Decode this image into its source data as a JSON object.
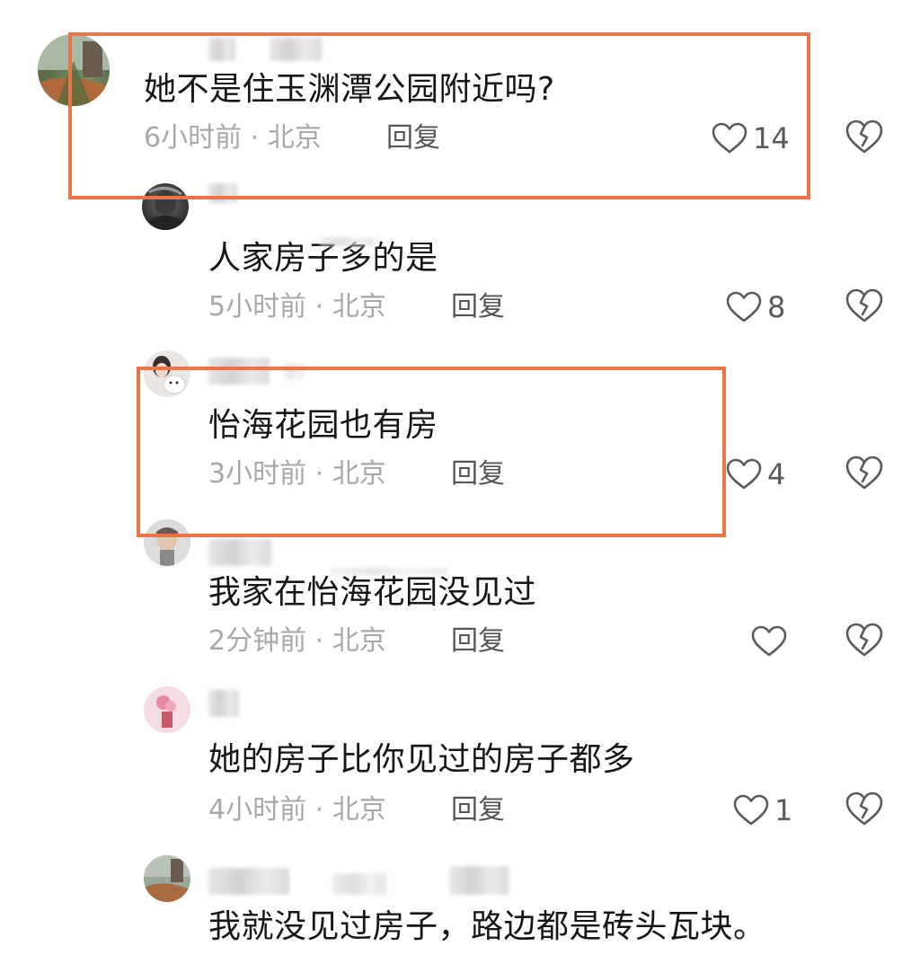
{
  "colors": {
    "highlight_border": "#e8744a",
    "text": "#161616",
    "meta": "#a8a8a8",
    "reply": "#555555",
    "icon": "#5a5a5a"
  },
  "comments": [
    {
      "text": "她不是住玉渊潭公园附近吗?",
      "time_location": "6小时前 · 北京",
      "reply_label": "回复",
      "likes": "14",
      "highlighted": true
    },
    {
      "text": "人家房子多的是",
      "time_location": "5小时前 · 北京",
      "reply_label": "回复",
      "likes": "8",
      "highlighted": false
    },
    {
      "text": "怡海花园也有房",
      "time_location": "3小时前 · 北京",
      "reply_label": "回复",
      "likes": "4",
      "highlighted": true
    },
    {
      "text": "我家在怡海花园没见过",
      "time_location": "2分钟前 · 北京",
      "reply_label": "回复",
      "likes": "",
      "highlighted": false
    },
    {
      "text": "她的房子比你见过的房子都多",
      "time_location": "4小时前 · 北京",
      "reply_label": "回复",
      "likes": "1",
      "highlighted": false
    },
    {
      "text": "我就没见过房子，路边都是砖头瓦块。",
      "time_location": "",
      "reply_label": "",
      "likes": "",
      "highlighted": false
    }
  ],
  "icons": {
    "like": "heart-outline-icon",
    "dislike": "broken-heart-icon"
  }
}
